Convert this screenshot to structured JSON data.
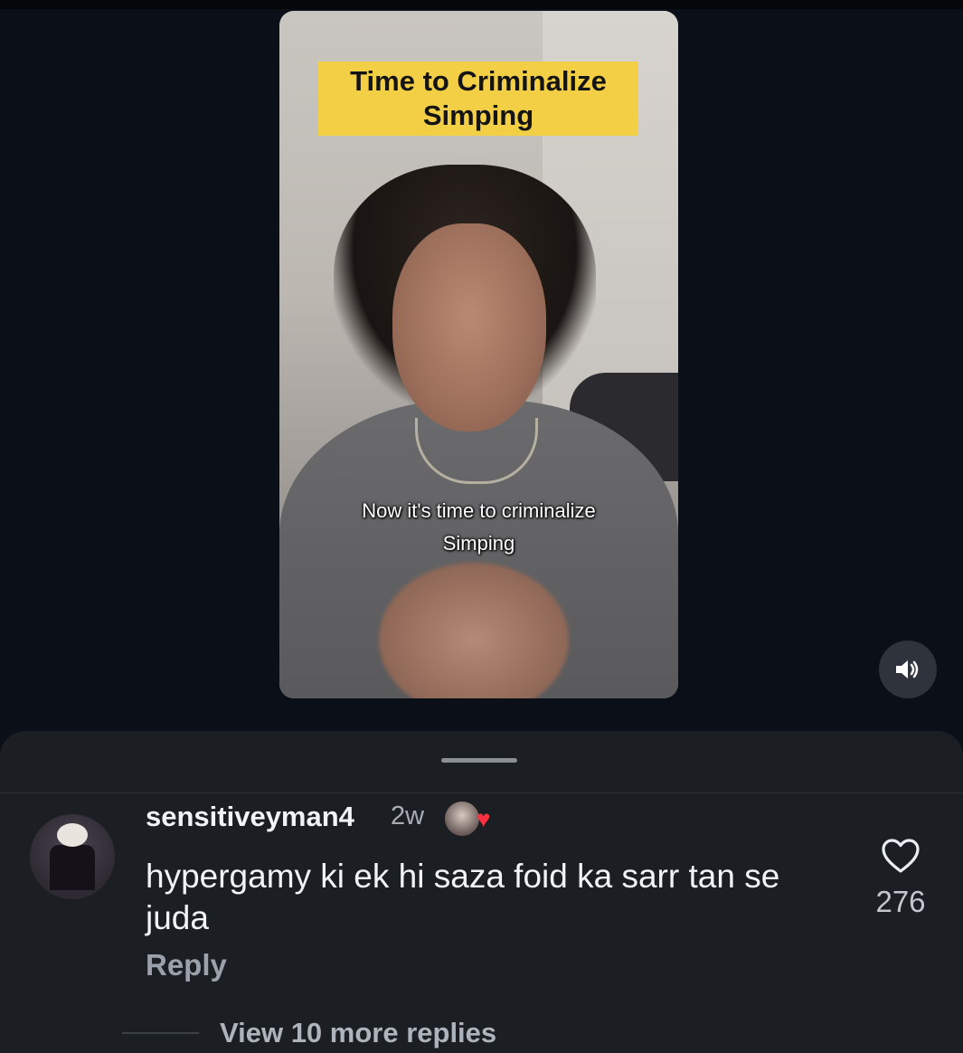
{
  "video": {
    "banner_line1": "Time to Criminalize",
    "banner_line2": "Simping",
    "subtitle_line1": "Now it's time to criminalize",
    "subtitle_line2": "Simping"
  },
  "sound_button": {
    "icon": "speaker-volume-icon"
  },
  "comment": {
    "username": "sensitiveyman4",
    "age": "2w",
    "text": "hypergamy ki ek hi saza foid ka sarr tan se juda",
    "reply_label": "Reply",
    "like_count": "276",
    "creator_like_icon": "heart-icon",
    "colors": {
      "heart": "#ff3040"
    }
  },
  "replies": {
    "view_more_label": "View 10 more replies"
  }
}
